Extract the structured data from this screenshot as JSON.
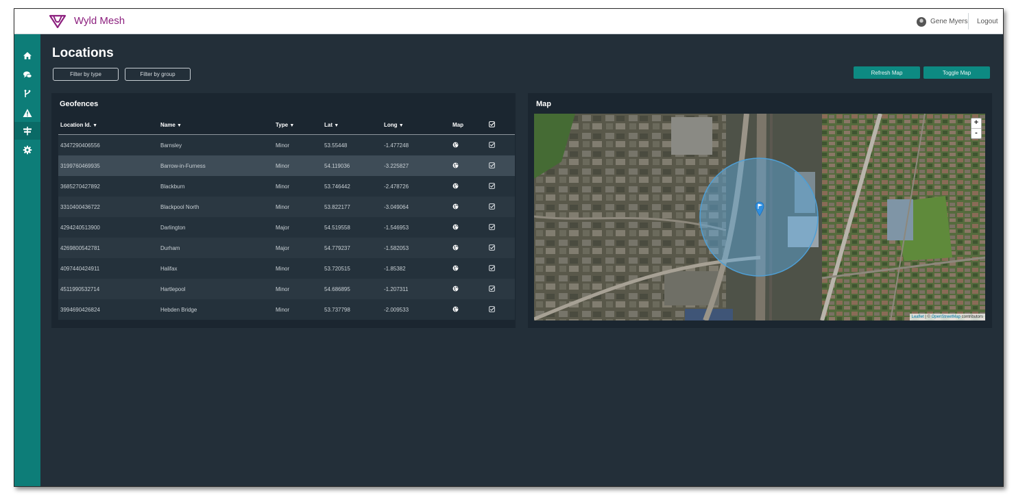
{
  "app": {
    "name": "Wyld Mesh",
    "brand_color": "#8c1f7e",
    "accent": "#0d7d78"
  },
  "user": {
    "name": "Gene Myers",
    "logout_label": "Logout"
  },
  "sidebar": {
    "items": [
      {
        "icon": "home-icon"
      },
      {
        "icon": "chat-icon"
      },
      {
        "icon": "branch-icon"
      },
      {
        "icon": "warning-icon"
      },
      {
        "icon": "signpost-icon",
        "active": true
      },
      {
        "icon": "gear-icon"
      }
    ]
  },
  "page": {
    "title": "Locations",
    "filter_type_label": "Filter by type",
    "filter_group_label": "Filter by group",
    "refresh_map_label": "Refresh Map",
    "toggle_map_label": "Toggle Map"
  },
  "geofences": {
    "title": "Geofences",
    "columns": {
      "location_id": "Location Id.",
      "name": "Name",
      "type": "Type",
      "lat": "Lat",
      "long": "Long",
      "map": "Map"
    },
    "selected_row": 1,
    "rows": [
      {
        "id": "4347290406556",
        "name": "Barnsley",
        "type": "Minor",
        "lat": "53.55448",
        "long": "-1.477248"
      },
      {
        "id": "3199760469935",
        "name": "Barrow-in-Furness",
        "type": "Minor",
        "lat": "54.119036",
        "long": "-3.225827"
      },
      {
        "id": "3685270427892",
        "name": "Blackburn",
        "type": "Minor",
        "lat": "53.746442",
        "long": "-2.478726"
      },
      {
        "id": "3310400436722",
        "name": "Blackpool North",
        "type": "Minor",
        "lat": "53.822177",
        "long": "-3.049064"
      },
      {
        "id": "4294240513900",
        "name": "Darlington",
        "type": "Major",
        "lat": "54.519558",
        "long": "-1.546953"
      },
      {
        "id": "4269800542781",
        "name": "Durham",
        "type": "Major",
        "lat": "54.779237",
        "long": "-1.582053"
      },
      {
        "id": "4097440424911",
        "name": "Halifax",
        "type": "Minor",
        "lat": "53.720515",
        "long": "-1.85382"
      },
      {
        "id": "4511990532714",
        "name": "Hartlepool",
        "type": "Minor",
        "lat": "54.686895",
        "long": "-1.207311"
      },
      {
        "id": "3994690426824",
        "name": "Hebden Bridge",
        "type": "Minor",
        "lat": "53.737798",
        "long": "-2.009533"
      }
    ]
  },
  "map": {
    "title": "Map",
    "zoom_in": "+",
    "zoom_out": "-",
    "attribution": {
      "leaflet": "Leaflet",
      "separator": " | © ",
      "osm": "OpenStreetMap",
      "suffix": " contributors"
    }
  }
}
